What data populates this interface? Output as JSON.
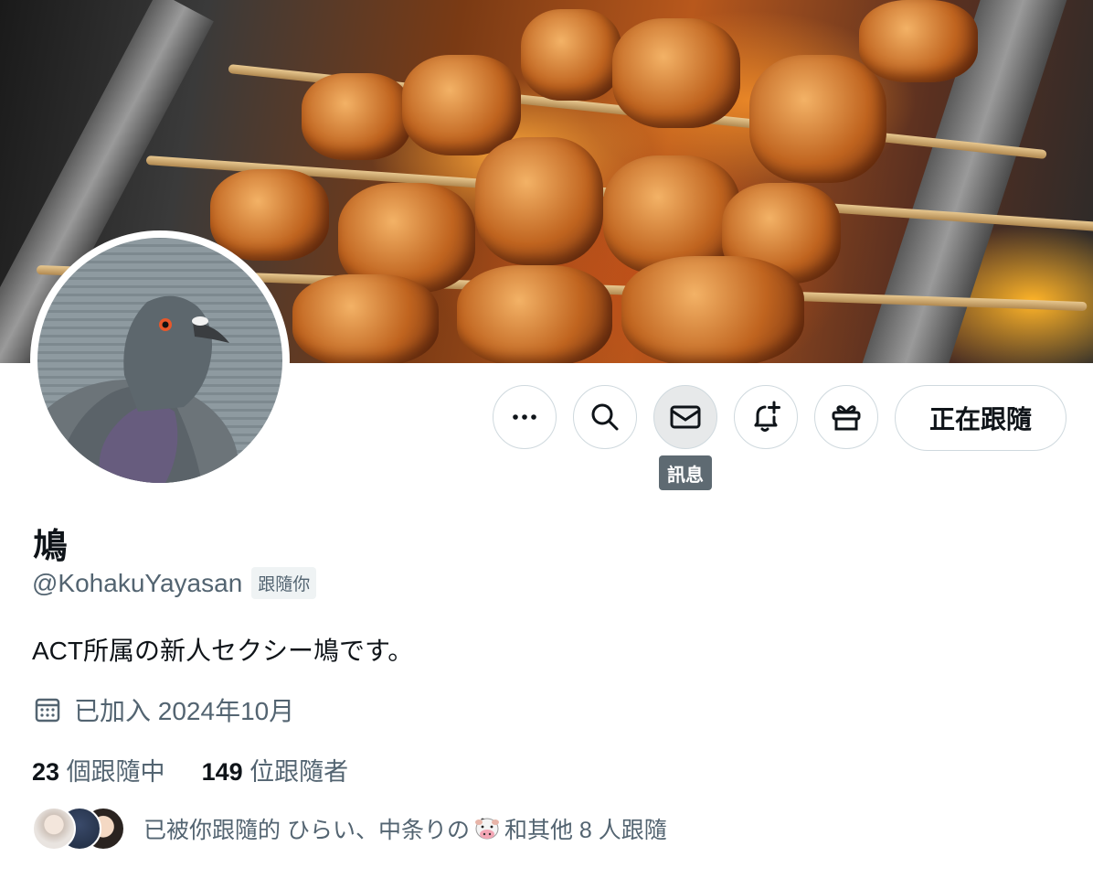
{
  "profile": {
    "display_name": "鳩",
    "handle": "@KohakuYayasan",
    "follows_you_badge": "跟隨你",
    "bio": "ACT所属の新人セクシー鳩です。",
    "joined": "已加入 2024年10月"
  },
  "actions": {
    "more_icon": "more-icon",
    "search_icon": "search-icon",
    "message_icon": "mail-icon",
    "notify_icon": "bell-plus-icon",
    "gift_icon": "gift-icon",
    "following_label": "正在跟隨",
    "tooltip": "訊息"
  },
  "stats": {
    "following_count": "23",
    "following_label": "個跟隨中",
    "followers_count": "149",
    "followers_label": "位跟隨者"
  },
  "followers_you_know": {
    "text_prefix": "已被你跟隨的 ひらい、中条りの",
    "text_suffix": "和其他 8 人跟隨"
  },
  "colors": {
    "text_primary": "#0f1419",
    "text_secondary": "#536471",
    "border": "#cfd9de",
    "tooltip_bg": "#5e6a72"
  }
}
